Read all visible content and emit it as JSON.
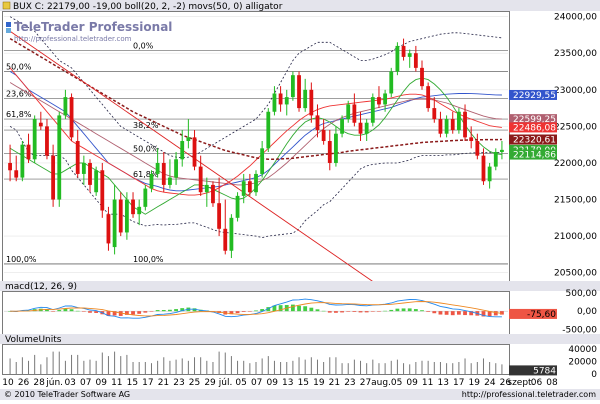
{
  "header": {
    "main_label": "BUX C: 22179,00 -19,00 boll(20, 2, -2) movs(50, 0) alligator",
    "macd_label": "macd(12, 26, 9)",
    "volume_label": "VolumeUnits"
  },
  "brand": {
    "logo_text": "TeleTrader Professional",
    "logo_url": "http://professional.teletrader.com",
    "copyright": "© 2010 TeleTrader Software AG",
    "footer_url": "http://professional.teletrader.com"
  },
  "colors": {
    "up": "#22bb22",
    "down": "#dd1111",
    "ma50": "#8b1a1a",
    "boll_mid": "#3355cc",
    "boll_band": "#222244",
    "jaw": "#b06070",
    "teeth": "#ee3333",
    "lips": "#33aa33",
    "trend": "#dd2222",
    "macd_line": "#2288ee",
    "signal_line": "#ee8822",
    "hist_pos": "#44cc44",
    "hist_neg": "#ee5544"
  },
  "chart_data": {
    "type": "candlestick",
    "instrument": "BUX C",
    "last": "22179,00",
    "change": "-19,00",
    "ylim": [
      20400,
      24050
    ],
    "y_ticks": [
      "24000,00",
      "23500,00",
      "23000,00",
      "22500,00",
      "22000,00",
      "21500,00",
      "21000,00",
      "20500,00"
    ],
    "x_labels": [
      "10",
      "26",
      "28",
      "jún.",
      "03",
      "07",
      "09",
      "11",
      "15",
      "17",
      "21",
      "23",
      "25",
      "29",
      "júl.",
      "05",
      "07",
      "09",
      "13",
      "15",
      "19",
      "21",
      "23",
      "27",
      "aug.",
      "05",
      "09",
      "11",
      "13",
      "17",
      "19",
      "24",
      "26",
      "szept.",
      "06",
      "08"
    ],
    "price_tags": [
      {
        "label": "22929,55",
        "value": 22929.55,
        "color": "#3355cc"
      },
      {
        "label": "22599,25",
        "value": 22599.25,
        "color": "#b06070"
      },
      {
        "label": "22486,08",
        "value": 22486.08,
        "color": "#ee3333"
      },
      {
        "label": "22320,61",
        "value": 22320.61,
        "color": "#8b1a1a"
      },
      {
        "label": "22179,00",
        "value": 22179.0,
        "color": "#33aa33"
      },
      {
        "label": "22114,86",
        "value": 22114.86,
        "color": "#33aa33"
      }
    ],
    "fib_levels": [
      {
        "label": "0,0%",
        "value": 23540
      },
      {
        "label": "38,2%",
        "value": 22450
      },
      {
        "label": "50,0%",
        "value": 22130
      },
      {
        "label": "61,8%",
        "value": 21780
      },
      {
        "label": "100,0%",
        "value": 20620
      }
    ],
    "fib_levels_2": [
      {
        "label": "50,0%",
        "value": 23250
      },
      {
        "label": "23,6%",
        "value": 22880
      },
      {
        "label": "61,8%",
        "value": 22600
      },
      {
        "label": "100,0%",
        "value": 20620
      }
    ],
    "candles": [
      [
        22000,
        22250,
        21750,
        21900
      ],
      [
        21900,
        22100,
        21750,
        21800
      ],
      [
        21800,
        22300,
        21750,
        22250
      ],
      [
        22250,
        22400,
        22000,
        22050
      ],
      [
        22050,
        22650,
        22000,
        22600
      ],
      [
        22550,
        22700,
        22450,
        22500
      ],
      [
        22500,
        22600,
        22050,
        22100
      ],
      [
        22100,
        22250,
        21400,
        21500
      ],
      [
        21500,
        22700,
        21400,
        22650
      ],
      [
        22650,
        23000,
        22600,
        22900
      ],
      [
        22900,
        22950,
        22300,
        22350
      ],
      [
        22300,
        22450,
        21800,
        21850
      ],
      [
        21850,
        22100,
        21700,
        22000
      ],
      [
        22000,
        22050,
        21600,
        21700
      ],
      [
        21600,
        21950,
        21550,
        21900
      ],
      [
        21900,
        22000,
        21250,
        21350
      ],
      [
        21300,
        21400,
        20800,
        20900
      ],
      [
        20850,
        21700,
        20750,
        21500
      ],
      [
        21500,
        21600,
        21000,
        21050
      ],
      [
        21050,
        21600,
        20950,
        21500
      ],
      [
        21500,
        21600,
        21250,
        21300
      ],
      [
        21300,
        21500,
        21150,
        21400
      ],
      [
        21400,
        21700,
        21350,
        21650
      ],
      [
        21650,
        21900,
        21600,
        21850
      ],
      [
        21850,
        22200,
        21800,
        22000
      ],
      [
        22000,
        22150,
        21600,
        21700
      ],
      [
        21700,
        22050,
        21650,
        21800
      ],
      [
        21800,
        22150,
        21700,
        22050
      ],
      [
        22050,
        22450,
        21950,
        22300
      ],
      [
        22300,
        22600,
        22200,
        22350
      ],
      [
        22350,
        22450,
        21900,
        21950
      ],
      [
        21950,
        22100,
        21550,
        21600
      ],
      [
        21600,
        21800,
        21400,
        21700
      ],
      [
        21700,
        21750,
        21400,
        21450
      ],
      [
        21450,
        21800,
        21000,
        21100
      ],
      [
        21100,
        21500,
        20750,
        20800
      ],
      [
        20800,
        21300,
        20700,
        21250
      ],
      [
        21250,
        21600,
        21200,
        21550
      ],
      [
        21550,
        21850,
        21450,
        21750
      ],
      [
        21750,
        21850,
        21550,
        21600
      ],
      [
        21600,
        21900,
        21550,
        21850
      ],
      [
        21850,
        22300,
        21800,
        22200
      ],
      [
        22200,
        22750,
        22150,
        22700
      ],
      [
        22700,
        23050,
        22650,
        22950
      ],
      [
        22950,
        23050,
        22700,
        22800
      ],
      [
        22800,
        23000,
        22650,
        22900
      ],
      [
        22900,
        23250,
        22850,
        23200
      ],
      [
        23200,
        23250,
        22700,
        22750
      ],
      [
        22750,
        23150,
        22700,
        23000
      ],
      [
        23000,
        23100,
        22550,
        22650
      ],
      [
        22650,
        22800,
        22350,
        22450
      ],
      [
        22450,
        22600,
        22250,
        22300
      ],
      [
        22300,
        22450,
        21900,
        22000
      ],
      [
        22000,
        22500,
        21950,
        22400
      ],
      [
        22400,
        22650,
        22350,
        22600
      ],
      [
        22600,
        22850,
        22550,
        22800
      ],
      [
        22800,
        22950,
        22500,
        22550
      ],
      [
        22550,
        22700,
        22300,
        22400
      ],
      [
        22400,
        22600,
        22300,
        22550
      ],
      [
        22550,
        22950,
        22500,
        22900
      ],
      [
        22900,
        23050,
        22750,
        22800
      ],
      [
        22800,
        23000,
        22700,
        22950
      ],
      [
        22950,
        23300,
        22900,
        23250
      ],
      [
        23250,
        23650,
        23200,
        23600
      ],
      [
        23600,
        23700,
        23400,
        23450
      ],
      [
        23450,
        23550,
        23300,
        23500
      ],
      [
        23500,
        23600,
        23250,
        23300
      ],
      [
        23300,
        23400,
        23000,
        23050
      ],
      [
        23050,
        23100,
        22700,
        22750
      ],
      [
        22750,
        22900,
        22550,
        22600
      ],
      [
        22600,
        22700,
        22350,
        22400
      ],
      [
        22400,
        22650,
        22350,
        22600
      ],
      [
        22600,
        22700,
        22400,
        22450
      ],
      [
        22450,
        22750,
        22400,
        22700
      ],
      [
        22700,
        22800,
        22300,
        22350
      ],
      [
        22350,
        22500,
        22200,
        22300
      ],
      [
        22300,
        22400,
        22050,
        22100
      ],
      [
        22100,
        22200,
        21700,
        21750
      ],
      [
        21750,
        22000,
        21650,
        21950
      ],
      [
        21950,
        22200,
        21900,
        22150
      ],
      [
        22150,
        22300,
        22050,
        22179
      ]
    ],
    "ma50": [
      23700,
      23650,
      23600,
      23550,
      23500,
      23450,
      23400,
      23350,
      23300,
      23250,
      23200,
      23150,
      23100,
      23050,
      23000,
      22950,
      22900,
      22850,
      22800,
      22750,
      22700,
      22660,
      22620,
      22580,
      22540,
      22500,
      22460,
      22420,
      22380,
      22350,
      22320,
      22290,
      22260,
      22230,
      22200,
      22170,
      22150,
      22130,
      22110,
      22090,
      22070,
      22060,
      22050,
      22050,
      22055,
      22060,
      22065,
      22075,
      22085,
      22095,
      22105,
      22115,
      22125,
      22135,
      22145,
      22160,
      22170,
      22180,
      22190,
      22200,
      22210,
      22220,
      22230,
      22240,
      22250,
      22260,
      22270,
      22280,
      22285,
      22290,
      22295,
      22300,
      22305,
      22310,
      22312,
      22314,
      22316,
      22318,
      22319,
      22320,
      22320.61
    ],
    "boll_mid": [
      23250,
      23200,
      23100,
      23000,
      22950,
      22900,
      22850,
      22800,
      22750,
      22700,
      22600,
      22500,
      22400,
      22300,
      22200,
      22100,
      22000,
      21950,
      21900,
      21850,
      21800,
      21760,
      21720,
      21700,
      21680,
      21650,
      21630,
      21620,
      21620,
      21630,
      21640,
      21650,
      21660,
      21670,
      21680,
      21700,
      21720,
      21740,
      21760,
      21780,
      21800,
      21840,
      21900,
      21980,
      22060,
      22140,
      22220,
      22300,
      22380,
      22440,
      22500,
      22540,
      22560,
      22580,
      22600,
      22620,
      22640,
      22660,
      22680,
      22700,
      22720,
      22740,
      22760,
      22790,
      22820,
      22850,
      22880,
      22900,
      22910,
      22920,
      22930,
      22940,
      22945,
      22950,
      22950,
      22948,
      22945,
      22940,
      22935,
      22930,
      22929.55
    ],
    "boll_up": [
      24000,
      23950,
      23900,
      23850,
      23800,
      23700,
      23600,
      23500,
      23400,
      23350,
      23300,
      23200,
      23100,
      23000,
      22900,
      22800,
      22700,
      22600,
      22500,
      22450,
      22400,
      22350,
      22300,
      22250,
      22200,
      22150,
      22100,
      22080,
      22070,
      22080,
      22100,
      22150,
      22200,
      22250,
      22300,
      22350,
      22400,
      22450,
      22500,
      22550,
      22600,
      22700,
      22800,
      22950,
      23100,
      23250,
      23400,
      23500,
      23550,
      23600,
      23650,
      23650,
      23650,
      23600,
      23550,
      23500,
      23450,
      23400,
      23400,
      23420,
      23450,
      23480,
      23520,
      23580,
      23620,
      23660,
      23680,
      23700,
      23720,
      23740,
      23760,
      23770,
      23780,
      23780,
      23770,
      23760,
      23750,
      23740,
      23730,
      23720,
      23710
    ],
    "boll_low": [
      22500,
      22450,
      22300,
      22150,
      22100,
      22100,
      22100,
      22100,
      22100,
      22050,
      21900,
      21800,
      21700,
      21600,
      21500,
      21400,
      21300,
      21300,
      21300,
      21250,
      21200,
      21170,
      21140,
      21150,
      21160,
      21150,
      21160,
      21160,
      21170,
      21180,
      21180,
      21150,
      21120,
      21090,
      21060,
      21050,
      21040,
      21030,
      21020,
      21010,
      21000,
      20980,
      21000,
      21010,
      21020,
      21030,
      21040,
      21100,
      21210,
      21280,
      21350,
      21430,
      21470,
      21560,
      21650,
      21740,
      21830,
      21920,
      21960,
      21980,
      21990,
      22000,
      22000,
      22000,
      22020,
      22040,
      22080,
      22100,
      22100,
      22100,
      22100,
      22110,
      22110,
      22120,
      22130,
      22136,
      22140,
      22140,
      22140,
      22140,
      22149
    ],
    "jaw": [
      23100,
      23050,
      23000,
      22950,
      22900,
      22850,
      22800,
      22750,
      22700,
      22650,
      22600,
      22550,
      22500,
      22450,
      22400,
      22350,
      22300,
      22250,
      22200,
      22150,
      22100,
      22050,
      22000,
      21950,
      21900,
      21850,
      21820,
      21800,
      21790,
      21780,
      21770,
      21760,
      21750,
      21740,
      21730,
      21720,
      21710,
      21700,
      21700,
      21710,
      21730,
      21760,
      21800,
      21860,
      21930,
      22000,
      22080,
      22160,
      22240,
      22320,
      22400,
      22470,
      22530,
      22580,
      22620,
      22650,
      22680,
      22700,
      22720,
      22740,
      22760,
      22780,
      22800,
      22820,
      22840,
      22860,
      22870,
      22875,
      22870,
      22860,
      22840,
      22820,
      22790,
      22760,
      22730,
      22700,
      22670,
      22640,
      22620,
      22605,
      22599.25
    ],
    "teeth": [
      23300,
      23200,
      23100,
      23000,
      22900,
      22800,
      22700,
      22600,
      22500,
      22400,
      22300,
      22250,
      22200,
      22150,
      22100,
      22050,
      22000,
      21950,
      21900,
      21850,
      21800,
      21750,
      21700,
      21650,
      21620,
      21600,
      21590,
      21580,
      21570,
      21560,
      21560,
      21570,
      21590,
      21620,
      21660,
      21710,
      21760,
      21820,
      21890,
      21960,
      22040,
      22120,
      22200,
      22280,
      22360,
      22440,
      22510,
      22580,
      22640,
      22690,
      22730,
      22760,
      22780,
      22790,
      22800,
      22810,
      22820,
      22830,
      22840,
      22850,
      22860,
      22870,
      22890,
      22910,
      22930,
      22940,
      22940,
      22930,
      22900,
      22860,
      22810,
      22760,
      22710,
      22670,
      22630,
      22600,
      22570,
      22540,
      22510,
      22495,
      22486.08
    ],
    "lips": [
      22200,
      22150,
      22100,
      22050,
      22000,
      21950,
      21900,
      21850,
      21850,
      21900,
      21950,
      22000,
      22000,
      21950,
      21900,
      21850,
      21800,
      21700,
      21600,
      21500,
      21400,
      21350,
      21300,
      21350,
      21400,
      21450,
      21500,
      21550,
      21600,
      21650,
      21700,
      21700,
      21680,
      21640,
      21600,
      21560,
      21520,
      21500,
      21520,
      21580,
      21660,
      21760,
      21880,
      22000,
      22130,
      22260,
      22380,
      22480,
      22560,
      22600,
      22620,
      22600,
      22560,
      22500,
      22440,
      22400,
      22380,
      22380,
      22400,
      22450,
      22520,
      22620,
      22740,
      22860,
      22980,
      23080,
      23140,
      23160,
      23140,
      23080,
      23000,
      22900,
      22780,
      22650,
      22520,
      22400,
      22300,
      22220,
      22160,
      22125,
      22114.86
    ],
    "trend_line": [
      [
        0,
        23800
      ],
      [
        59,
        20380
      ]
    ],
    "macd": {
      "ylim": [
        -600,
        500
      ],
      "y_ticks": [
        "500,00",
        "0,00",
        "-500,00"
      ],
      "last_label": "-75,60",
      "last_value": -75.6
    },
    "volume": {
      "ylim": [
        0,
        45000
      ],
      "y_ticks": [
        "40000",
        "20000",
        "0"
      ],
      "last_label": "5784",
      "last_value": 5784
    }
  }
}
